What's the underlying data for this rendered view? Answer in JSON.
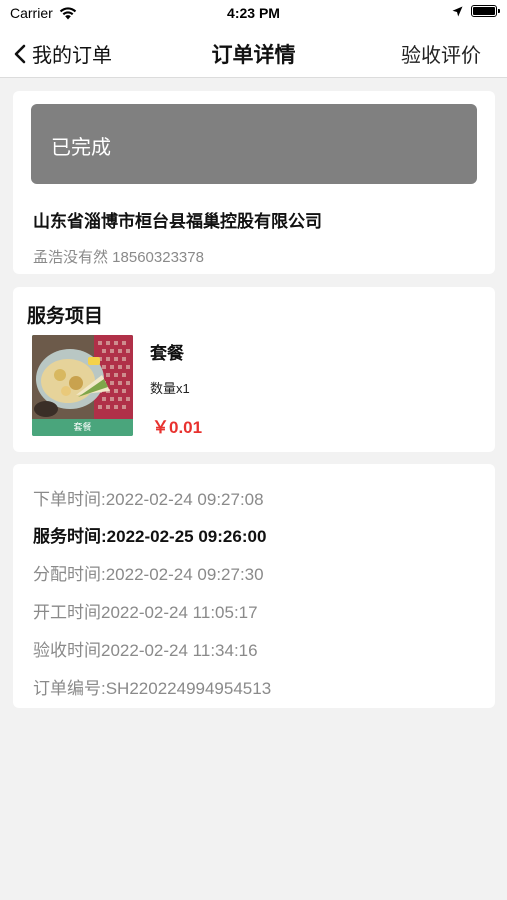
{
  "status_bar": {
    "carrier": "Carrier",
    "time": "4:23 PM"
  },
  "nav": {
    "back_label": "我的订单",
    "title": "订单详情",
    "action_label": "验收评价"
  },
  "order_status": {
    "label": "已完成",
    "banner_color": "#808080"
  },
  "address": {
    "company": "山东省淄博市桓台县福巢控股有限公司",
    "contact": "孟浩没有然 18560323378"
  },
  "service": {
    "section_title": "服务项目",
    "item": {
      "name": "套餐",
      "quantity": "数量x1",
      "price": "￥0.01",
      "image_caption": "套餐"
    }
  },
  "times": {
    "order_time": "下单时间:2022-02-24 09:27:08",
    "service_time": "服务时间:2022-02-25 09:26:00",
    "assign_time": "分配时间:2022-02-24 09:27:30",
    "start_time": "开工时间2022-02-24 11:05:17",
    "accept_time": "验收时间2022-02-24 11:34:16",
    "order_number": "订单编号:SH220224994954513"
  },
  "colors": {
    "price": "#e8322f",
    "muted_text": "#8a8a8a",
    "background": "#f2f2f2"
  }
}
